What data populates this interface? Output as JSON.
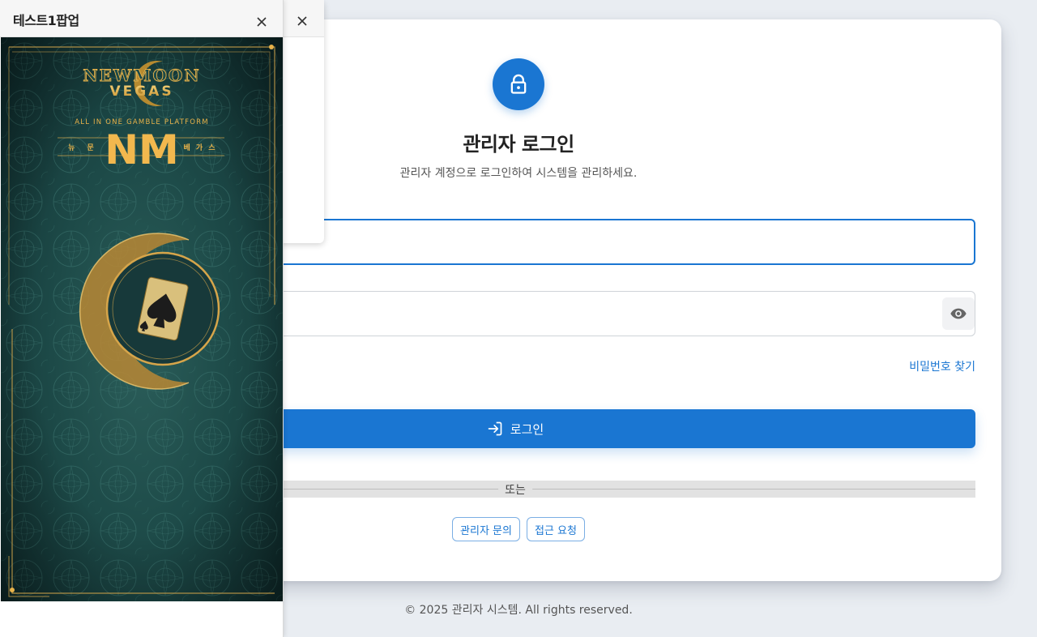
{
  "login": {
    "title": "관리자 로그인",
    "subtitle": "관리자 계정으로 로그인하여 시스템을 관리하세요.",
    "username_value": "",
    "password_value": "",
    "find_password": "비밀번호 찾기",
    "login_button": "로그인",
    "divider": "또는",
    "contact_admin": "관리자 문의",
    "access_request": "접근 요청"
  },
  "footer": {
    "text": "© 2025 관리자 시스템. All rights reserved."
  },
  "popup": {
    "title": "테스트1팝업",
    "banner": {
      "brand_line1": "NEWMOON",
      "brand_line2": "VEGAS",
      "tagline": "ALL IN ONE GAMBLE PLATFORM",
      "logo": "NM",
      "left_word": "뉴 문",
      "right_word": "베 가 스"
    }
  },
  "colors": {
    "primary": "#1a76d2",
    "page_bg": "#e9edf2",
    "banner_green": "#1d4a48",
    "gold": "#e8b24a"
  },
  "icons": {
    "lock": "lock-icon",
    "eye": "eye-icon",
    "login": "login-arrow-icon",
    "close": "close-icon"
  }
}
